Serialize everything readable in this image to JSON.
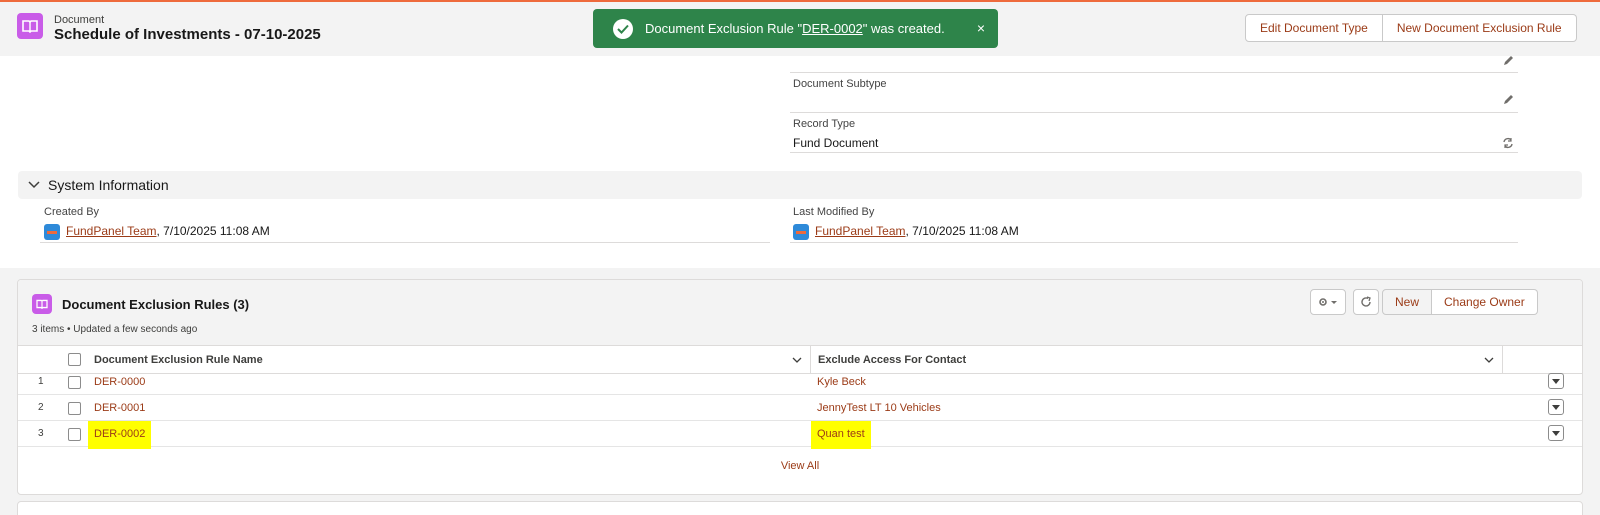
{
  "header": {
    "object_label": "Document",
    "title": "Schedule of Investments - 07-10-2025",
    "buttons": [
      "Edit Document Type",
      "New Document Exclusion Rule"
    ]
  },
  "toast": {
    "prefix": "Document Exclusion Rule \"",
    "link": "DER-0002",
    "suffix": "\" was created.",
    "close": "×"
  },
  "details": {
    "subtype_label": "Document Subtype",
    "subtype_value": "",
    "record_type_label": "Record Type",
    "record_type_value": "Fund Document"
  },
  "system_info": {
    "section_title": "System Information",
    "created_by_label": "Created By",
    "created_by_user": "FundPanel Team",
    "created_by_date": ", 7/10/2025 11:08 AM",
    "modified_by_label": "Last Modified By",
    "modified_by_user": "FundPanel Team",
    "modified_by_date": ", 7/10/2025 11:08 AM"
  },
  "related_list": {
    "title": "Document Exclusion Rules (3)",
    "meta": "3 items • Updated a few seconds ago",
    "new_button": "New",
    "change_owner_button": "Change Owner",
    "columns": [
      "Document Exclusion Rule Name",
      "Exclude Access For Contact"
    ],
    "rows": [
      {
        "num": "1",
        "name": "DER-0000",
        "contact": "Kyle Beck"
      },
      {
        "num": "2",
        "name": "DER-0001",
        "contact": "JennyTest LT 10 Vehicles"
      },
      {
        "num": "3",
        "name": "DER-0002",
        "contact": "Quan test"
      }
    ],
    "view_all": "View All"
  },
  "colors": {
    "accent_link": "#9b3b17",
    "toast_green": "#2e844a",
    "object_icon": "#c95ce8",
    "highlight": "#ffff00"
  }
}
